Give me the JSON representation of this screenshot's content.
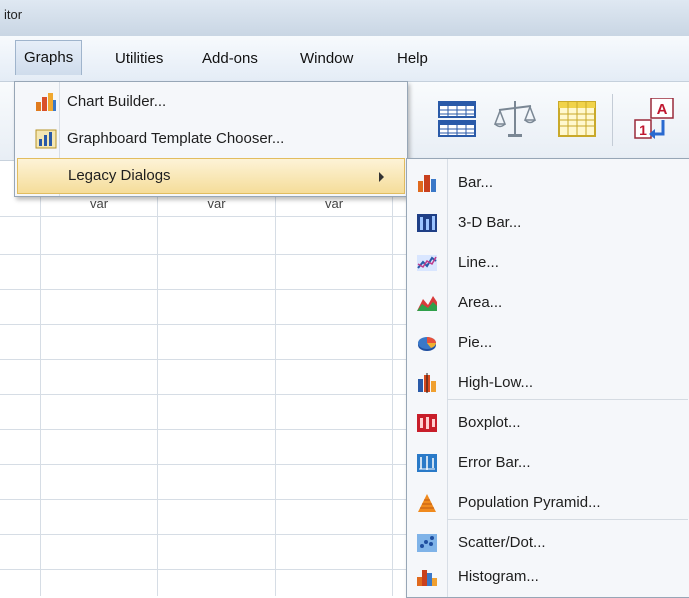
{
  "window": {
    "title": "itor"
  },
  "menubar": {
    "items": [
      {
        "label": "Graphs"
      },
      {
        "label": "Utilities"
      },
      {
        "label": "Add-ons"
      },
      {
        "label": "Window"
      },
      {
        "label": "Help"
      }
    ]
  },
  "grid": {
    "column_header": "var"
  },
  "graphs_menu": {
    "items": [
      {
        "label": "Chart Builder...",
        "icon": "chart-builder-icon"
      },
      {
        "label": "Graphboard Template Chooser...",
        "icon": "graphboard-icon"
      },
      {
        "label": "Legacy Dialogs",
        "icon": ""
      }
    ]
  },
  "legacy_submenu": {
    "items": [
      {
        "label": "Bar...",
        "icon": "bar-chart-icon"
      },
      {
        "label": "3-D Bar...",
        "icon": "3d-bar-icon"
      },
      {
        "label": "Line...",
        "icon": "line-chart-icon"
      },
      {
        "label": "Area...",
        "icon": "area-chart-icon"
      },
      {
        "label": "Pie...",
        "icon": "pie-chart-icon"
      },
      {
        "label": "High-Low...",
        "icon": "high-low-icon"
      },
      {
        "label": "Boxplot...",
        "icon": "boxplot-icon"
      },
      {
        "label": "Error Bar...",
        "icon": "error-bar-icon"
      },
      {
        "label": "Population Pyramid...",
        "icon": "pyramid-icon"
      },
      {
        "label": "Scatter/Dot...",
        "icon": "scatter-icon"
      },
      {
        "label": "Histogram...",
        "icon": "histogram-icon"
      }
    ]
  },
  "toolbar": {
    "icons": [
      "data-grid-icon",
      "weight-scale-icon",
      "split-table-icon",
      "value-labels-icon"
    ],
    "value_label_letter": "A",
    "value_label_number": "1"
  }
}
